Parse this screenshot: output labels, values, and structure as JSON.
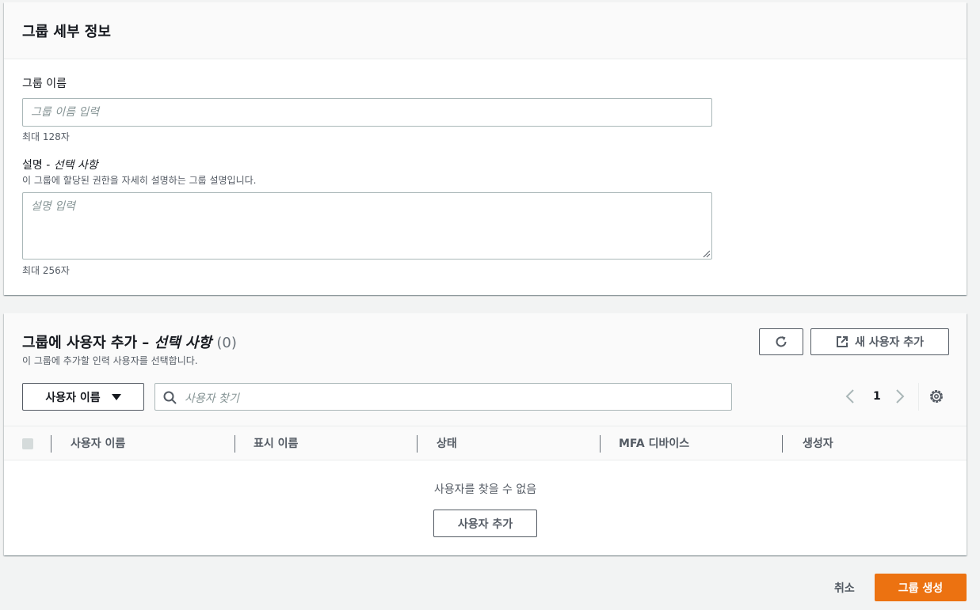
{
  "group_details": {
    "title": "그룹 세부 정보",
    "name_label": "그룹 이름",
    "name_placeholder": "그룹 이름 입력",
    "name_hint": "최대 128자",
    "desc_label": "설명 - ",
    "desc_optional": "선택 사항",
    "desc_description": "이 그룹에 할당된 권한을 자세히 설명하는 그룹 설명입니다.",
    "desc_placeholder": "설명 입력",
    "desc_hint": "최대 256자"
  },
  "add_users": {
    "title": "그룹에 사용자 추가 – ",
    "optional": "선택 사항",
    "count": "(0)",
    "subtitle": "이 그룹에 추가할 인력 사용자를 선택합니다.",
    "refresh_icon": "refresh-icon",
    "new_user_button": "새 사용자 추가",
    "filter_select": "사용자 이름",
    "search_placeholder": "사용자 찾기",
    "page_number": "1",
    "columns": [
      "사용자 이름",
      "표시 이름",
      "상태",
      "MFA 디바이스",
      "생성자"
    ],
    "empty_message": "사용자를 찾을 수 없음",
    "add_user_button": "사용자 추가"
  },
  "footer": {
    "cancel": "취소",
    "create": "그룹 생성"
  },
  "colors": {
    "primary": "#ec7211",
    "background": "#f2f3f3"
  }
}
